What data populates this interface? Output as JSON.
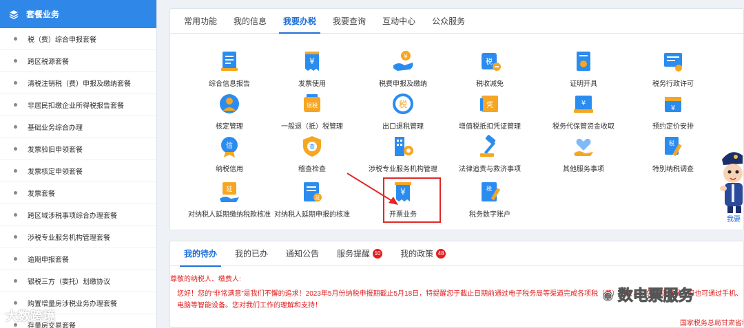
{
  "sidebar": {
    "header": "套餐业务",
    "items": [
      "税（费）综合申报套餐",
      "跨区税源套餐",
      "清税注销税（费）申报及缴纳套餐",
      "非居民扣缴企业所得税报告套餐",
      "基础业务综合办理",
      "发票验旧申领套餐",
      "发票核定申领套餐",
      "发票套餐",
      "跨区域涉税事项综合办理套餐",
      "涉税专业服务机构管理套餐",
      "逾期申报套餐",
      "银税三方（委托）划缴协议",
      "购置增量房涉税业务办理套餐",
      "存量房交易套餐"
    ]
  },
  "top_tabs": [
    "常用功能",
    "我的信息",
    "我要办税",
    "我要查询",
    "互动中心",
    "公众服务"
  ],
  "services": [
    {
      "label": "综合信息报告",
      "icon": "report-doc-icon"
    },
    {
      "label": "发票使用",
      "icon": "invoice-yen-icon"
    },
    {
      "label": "税费申报及缴纳",
      "icon": "hand-coin-icon"
    },
    {
      "label": "税收减免",
      "icon": "tax-reduce-icon"
    },
    {
      "label": "证明开具",
      "icon": "certificate-icon"
    },
    {
      "label": "税务行政许可",
      "icon": "license-icon"
    },
    {
      "label": "核定管理",
      "icon": "person-badge-icon"
    },
    {
      "label": "一般退（抵）税管理",
      "icon": "refund-icon"
    },
    {
      "label": "出口退税管理",
      "icon": "export-refund-icon"
    },
    {
      "label": "增值税抵扣凭证管理",
      "icon": "voucher-icon"
    },
    {
      "label": "税务代保管资金收取",
      "icon": "custody-funds-icon"
    },
    {
      "label": "预约定价安排",
      "icon": "calendar-yen-icon"
    },
    {
      "label": "纳税信用",
      "icon": "credit-medal-icon"
    },
    {
      "label": "稽查检查",
      "icon": "inspect-shield-icon"
    },
    {
      "label": "涉税专业服务机构管理",
      "icon": "building-gear-icon"
    },
    {
      "label": "法律追责与救济事项",
      "icon": "gavel-icon"
    },
    {
      "label": "其他服务事项",
      "icon": "heart-hand-icon"
    },
    {
      "label": "特别纳税调查",
      "icon": "tax-pen-icon"
    },
    {
      "label": "对纳税人延期缴纳税款核准",
      "icon": "extend-pay-icon"
    },
    {
      "label": "对纳税人延期申报的核准",
      "icon": "extend-declare-icon"
    },
    {
      "label": "开票业务",
      "icon": "issue-invoice-icon"
    },
    {
      "label": "税务数字账户",
      "icon": "digital-account-icon"
    }
  ],
  "bottom_tabs": [
    {
      "label": "我的待办",
      "badge": ""
    },
    {
      "label": "我的已办",
      "badge": ""
    },
    {
      "label": "通知公告",
      "badge": ""
    },
    {
      "label": "服务提醒",
      "badge": "10"
    },
    {
      "label": "我的政策",
      "badge": "48"
    }
  ],
  "notice": {
    "greeting": "尊敬的纳税人、缴费人:",
    "body": "您好！您的“非常满意”是我们不懈的追求！2023年5月份纳税申报期截止5月18日，特提醒您于截止日期前通过电子税务局等渠道完成各项税（费）申报，以免逾期申报。您也可通过手机、电脑等智能设备。您对我们工作的理解和支持！",
    "signature": "国家税务总局甘肃省税"
  },
  "mascot": {
    "label": "我要"
  },
  "watermarks": {
    "left": "大数跨境",
    "right": "数电票服务"
  },
  "colors": {
    "accent": "#1f6fd8",
    "sidebar_header": "#2f88e8",
    "alert": "#e02020"
  }
}
